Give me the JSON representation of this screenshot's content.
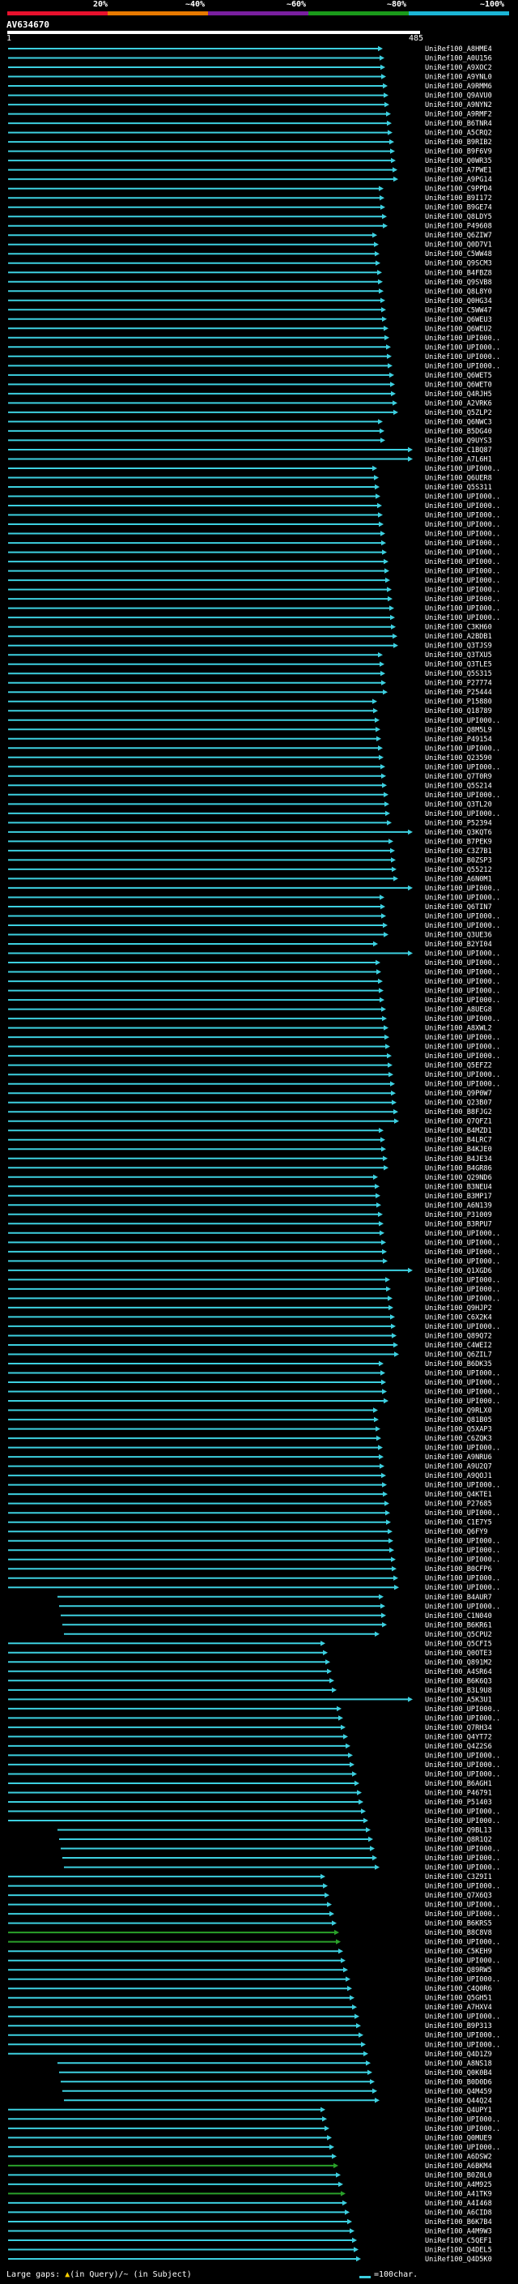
{
  "header": {
    "percent_labels": [
      "20%",
      "~40%",
      "~60%",
      "~80%",
      "~100%"
    ],
    "colors": [
      "#e8112d",
      "#e87a00",
      "#7a1fa0",
      "#1a9a1a",
      "#1bb5d6"
    ]
  },
  "query": {
    "name": "AV634670",
    "start": "1",
    "end": "485"
  },
  "colors": {
    "cyan": "#3dd0e0",
    "green": "#2aa12a",
    "yellow": "#f0e000"
  },
  "hits": [
    "UniRef100_A8HME4",
    "UniRef100_A0U156",
    "UniRef100_A9XOC2",
    "UniRef100_A9YNL0",
    "UniRef100_A9RMM6",
    "UniRef100_Q9AVU0",
    "UniRef100_A9NYN2",
    "UniRef100_A9RMF2",
    "UniRef100_B6TNR4",
    "UniRef100_A5CRQ2",
    "UniRef100_B9RIB2",
    "UniRef100_B9F6V9",
    "UniRef100_Q0WR35",
    "UniRef100_A7PWE1",
    "UniRef100_A9PG14",
    "UniRef100_C9PPD4",
    "UniRef100_B9I172",
    "UniRef100_B9GE74",
    "UniRef100_Q8LDY5",
    "UniRef100_P49608",
    "UniRef100_Q6ZIW7",
    "UniRef100_Q0D7V1",
    "UniRef100_C5WW48",
    "UniRef100_Q9SCM3",
    "UniRef100_B4FBZ8",
    "UniRef100_Q9SVB8",
    "UniRef100_Q8L8Y0",
    "UniRef100_Q0HG34",
    "UniRef100_C5WW47",
    "UniRef100_Q6WEU3",
    "UniRef100_Q6WEU2",
    "UniRef100_UPI000..",
    "UniRef100_UPI000..",
    "UniRef100_UPI000..",
    "UniRef100_UPI000..",
    "UniRef100_Q6WET5",
    "UniRef100_Q6WET0",
    "UniRef100_Q4RJH5",
    "UniRef100_A2VRK6",
    "UniRef100_Q5ZLP2",
    "UniRef100_Q6NWC3",
    "UniRef100_B5DG40",
    "UniRef100_Q9UYS3",
    "UniRef100_C1BQ87",
    "UniRef100_A7L6H1",
    "UniRef100_UPI000..",
    "UniRef100_Q6UER8",
    "UniRef100_Q5S311",
    "UniRef100_UPI000..",
    "UniRef100_UPI000..",
    "UniRef100_UPI000..",
    "UniRef100_UPI000..",
    "UniRef100_UPI000..",
    "UniRef100_UPI000..",
    "UniRef100_UPI000..",
    "UniRef100_UPI000..",
    "UniRef100_UPI000..",
    "UniRef100_UPI000..",
    "UniRef100_UPI000..",
    "UniRef100_UPI000..",
    "UniRef100_UPI000..",
    "UniRef100_UPI000..",
    "UniRef100_C3KH60",
    "UniRef100_A2BDB1",
    "UniRef100_Q3TJS9",
    "UniRef100_Q3TXU5",
    "UniRef100_Q3TLE5",
    "UniRef100_Q5S315",
    "UniRef100_P27774",
    "UniRef100_P25444",
    "UniRef100_P15880",
    "UniRef100_Q18789",
    "UniRef100_UPI000..",
    "UniRef100_Q8M5L9",
    "UniRef100_P49154",
    "UniRef100_UPI000..",
    "UniRef100_Q23590",
    "UniRef100_UPI000..",
    "UniRef100_Q7T0R9",
    "UniRef100_Q5S214",
    "UniRef100_UPI000..",
    "UniRef100_Q3TL20",
    "UniRef100_UPI000..",
    "UniRef100_P52394",
    "UniRef100_Q3KQT6",
    "UniRef100_B7PEK9",
    "UniRef100_C3Z7B1",
    "UniRef100_B0ZSP3",
    "UniRef100_Q55212",
    "UniRef100_A6N0M1",
    "UniRef100_UPI000..",
    "UniRef100_UPI000..",
    "UniRef100_Q6TIN7",
    "UniRef100_UPI000..",
    "UniRef100_UPI000..",
    "UniRef100_Q3UE36",
    "UniRef100_B2YI04",
    "UniRef100_UPI000..",
    "UniRef100_UPI000..",
    "UniRef100_UPI000..",
    "UniRef100_UPI000..",
    "UniRef100_UPI000..",
    "UniRef100_UPI000..",
    "UniRef100_A8UEG8",
    "UniRef100_UPI000..",
    "UniRef100_A8XWL2",
    "UniRef100_UPI000..",
    "UniRef100_UPI000..",
    "UniRef100_UPI000..",
    "UniRef100_Q5EFZ2",
    "UniRef100_UPI000..",
    "UniRef100_UPI000..",
    "UniRef100_Q9P0W7",
    "UniRef100_Q23B07",
    "UniRef100_B8FJG2",
    "UniRef100_Q7QFZ1",
    "UniRef100_B4MZD1",
    "UniRef100_B4LRC7",
    "UniRef100_B4KJE0",
    "UniRef100_B4JE34",
    "UniRef100_B4GR86",
    "UniRef100_Q29ND6",
    "UniRef100_B3NEU4",
    "UniRef100_B3MP17",
    "UniRef100_A6N139",
    "UniRef100_P31009",
    "UniRef100_B3RPU7",
    "UniRef100_UPI000..",
    "UniRef100_UPI000..",
    "UniRef100_UPI000..",
    "UniRef100_UPI000..",
    "UniRef100_Q1XGD6",
    "UniRef100_UPI000..",
    "UniRef100_UPI000..",
    "UniRef100_UPI000..",
    "UniRef100_Q9HJP2",
    "UniRef100_C6X2K4",
    "UniRef100_UPI000..",
    "UniRef100_Q89Q72",
    "UniRef100_C4WEI2",
    "UniRef100_Q6ZIL7",
    "UniRef100_B6DK35",
    "UniRef100_UPI000..",
    "UniRef100_UPI000..",
    "UniRef100_UPI000..",
    "UniRef100_UPI000..",
    "UniRef100_Q9RLX0",
    "UniRef100_Q81B05",
    "UniRef100_Q5XAP3",
    "UniRef100_C6ZQK3",
    "UniRef100_UPI000..",
    "UniRef100_A9NRU6",
    "UniRef100_A9U2Q7",
    "UniRef100_A9QOJ1",
    "UniRef100_UPI000..",
    "UniRef100_Q4KTE1",
    "UniRef100_P27685",
    "UniRef100_UPI000..",
    "UniRef100_C1E7Y5",
    "UniRef100_Q6FY9",
    "UniRef100_UPI000..",
    "UniRef100_UPI000..",
    "UniRef100_UPI000..",
    "UniRef100_B0CFP6",
    "UniRef100_UPI000..",
    "UniRef100_UPI000..",
    "UniRef100_B4AUR7",
    "UniRef100_UPI000..",
    "UniRef100_C1N040",
    "UniRef100_B6KR61",
    "UniRef100_Q5CPU2",
    "UniRef100_Q5CFI5",
    "UniRef100_Q0OTE3",
    "UniRef100_Q891M2",
    "UniRef100_A4SR64",
    "UniRef100_B6K6Q3",
    "UniRef100_B3L9U8",
    "UniRef100_A5K3U1",
    "UniRef100_UPI000..",
    "UniRef100_UPI000..",
    "UniRef100_Q7RH34",
    "UniRef100_Q4YT72",
    "UniRef100_Q4Z2S6",
    "UniRef100_UPI000..",
    "UniRef100_UPI000..",
    "UniRef100_UPI000..",
    "UniRef100_B6AGH1",
    "UniRef100_P46791",
    "UniRef100_P51403",
    "UniRef100_UPI000..",
    "UniRef100_UPI000..",
    "UniRef100_Q9BL13",
    "UniRef100_Q8R1Q2",
    "UniRef100_UPI000..",
    "UniRef100_UPI000..",
    "UniRef100_UPI000..",
    "UniRef100_C3Z9I1",
    "UniRef100_UPI000..",
    "UniRef100_Q7X6Q3",
    "UniRef100_UPI000..",
    "UniRef100_UPI000..",
    "UniRef100_B6KRS5",
    "UniRef100_B8C8V8",
    "UniRef100_UPI000..",
    "UniRef100_C5KEH9",
    "UniRef100_UPI000..",
    "UniRef100_Q89RW5",
    "UniRef100_UPI000..",
    "UniRef100_C4Q0R6",
    "UniRef100_Q5GH51",
    "UniRef100_A7HXV4",
    "UniRef100_UPI000..",
    "UniRef100_B9P313",
    "UniRef100_UPI000..",
    "UniRef100_UPI000..",
    "UniRef100_Q4D1Z9",
    "UniRef100_A8NS18",
    "UniRef100_Q0K0B4",
    "UniRef100_B0D0D6",
    "UniRef100_Q4M459",
    "UniRef100_Q44Q24",
    "UniRef100_Q4UPY1",
    "UniRef100_UPI000..",
    "UniRef100_UPI000..",
    "UniRef100_Q0MUE9",
    "UniRef100_UPI000..",
    "UniRef100_A6DSW2",
    "UniRef100_A6BKM4",
    "UniRef100_B0Z0L0",
    "UniRef100_A4M925",
    "UniRef100_A41TK9",
    "UniRef100_A4I468",
    "UniRef100_A6CID8",
    "UniRef100_B6K7B4",
    "UniRef100_A4M9W3",
    "UniRef100_C5QEF1",
    "UniRef100_Q4DEL5",
    "UniRef100_Q4D5K0"
  ],
  "legend": {
    "prefix": "Large gaps: ",
    "in_query_glyph": "▲",
    "in_query": "(in Query)/~ (in Subject)",
    "scale": "=100char."
  }
}
